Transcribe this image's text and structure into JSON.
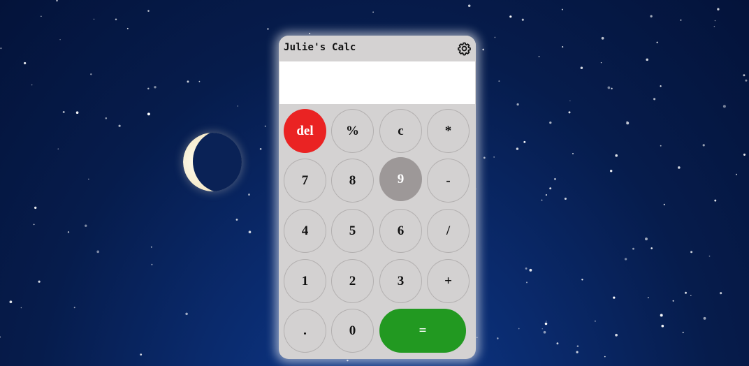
{
  "calculator": {
    "title": "Julie's Calc",
    "settings_icon": "gear-icon",
    "display_value": "",
    "keys": {
      "del": "del",
      "percent": "%",
      "clear": "c",
      "multiply": "*",
      "seven": "7",
      "eight": "8",
      "nine": "9",
      "minus": "-",
      "four": "4",
      "five": "5",
      "six": "6",
      "divide": "/",
      "one": "1",
      "two": "2",
      "three": "3",
      "plus": "+",
      "decimal": ".",
      "zero": "0",
      "equals": "="
    },
    "colors": {
      "body": "#d4d2d2",
      "delete": "#ea2323",
      "hovered_key": "#9d9898",
      "equals": "#229921"
    }
  },
  "background": {
    "scene": "night sky with crescent moon and stars"
  }
}
